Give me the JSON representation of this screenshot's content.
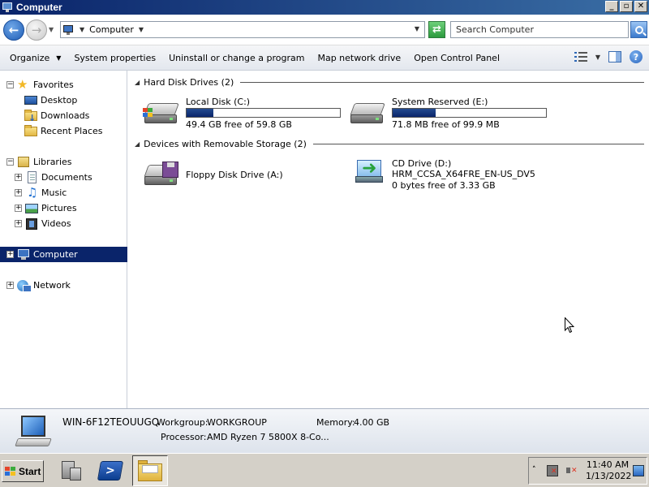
{
  "window": {
    "title": "Computer"
  },
  "title_buttons": {
    "minimize": "_",
    "maximize": "▫",
    "close": "✕"
  },
  "address": {
    "crumb": "Computer",
    "search_placeholder": "Search Computer"
  },
  "toolbar": {
    "organize": "Organize",
    "system_properties": "System properties",
    "uninstall": "Uninstall or change a program",
    "map_drive": "Map network drive",
    "control_panel": "Open Control Panel",
    "help": "?"
  },
  "nav": {
    "favorites": "Favorites",
    "desktop": "Desktop",
    "downloads": "Downloads",
    "recent_places": "Recent Places",
    "libraries": "Libraries",
    "documents": "Documents",
    "music": "Music",
    "pictures": "Pictures",
    "videos": "Videos",
    "computer": "Computer",
    "network": "Network"
  },
  "groups": {
    "hard_disks": "Hard Disk Drives (2)",
    "removable": "Devices with Removable Storage (2)"
  },
  "drives": {
    "c": {
      "name": "Local Disk (C:)",
      "free": "49.4 GB free of 59.8 GB",
      "used_fraction": 0.174
    },
    "e": {
      "name": "System Reserved (E:)",
      "free": "71.8 MB free of 99.9 MB",
      "used_fraction": 0.281
    },
    "a": {
      "name": "Floppy Disk Drive (A:)"
    },
    "d": {
      "name": "CD Drive (D:)",
      "volume": "HRM_CCSA_X64FRE_EN-US_DV5",
      "free": "0 bytes free of 3.33 GB"
    }
  },
  "details": {
    "computer_name": "WIN-6F12TEOUUGQ",
    "workgroup_label": "Workgroup:",
    "workgroup": "WORKGROUP",
    "memory_label": "Memory:",
    "memory": "4.00 GB",
    "processor_label": "Processor:",
    "processor": "AMD Ryzen 7 5800X 8-Co..."
  },
  "taskbar": {
    "start": "Start",
    "time": "11:40 AM",
    "date": "1/13/2022"
  },
  "colors": {
    "title_bar": "#0a246a",
    "selection": "#0a246a",
    "usage_bar": "#0a246a"
  }
}
